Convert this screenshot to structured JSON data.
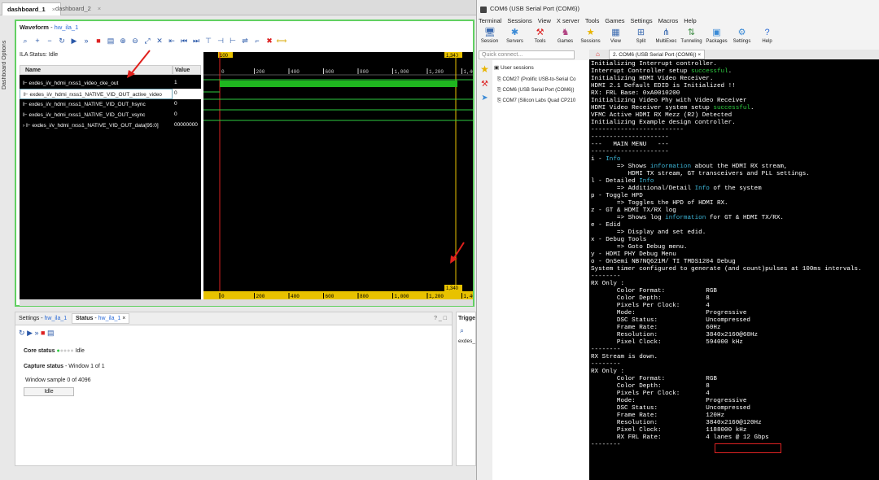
{
  "tabs": [
    {
      "label": "dashboard_1",
      "active": true
    },
    {
      "label": "dashboard_2",
      "active": false
    }
  ],
  "side_tab": "Dashboard Options",
  "waveform": {
    "title": "Waveform",
    "link": "hw_ila_1",
    "status_label": "ILA Status:",
    "status_value": "Idle",
    "name_header": "Name",
    "value_header": "Value",
    "signals": [
      {
        "name": "exdes_i/v_hdmi_rxss1_video_cke_out",
        "value": "1",
        "selected": false
      },
      {
        "name": "exdes_i/v_hdmi_rxss1_NATIVE_VID_OUT_active_video",
        "value": "0",
        "selected": true
      },
      {
        "name": "exdes_i/v_hdmi_rxss1_NATIVE_VID_OUT_hsync",
        "value": "0",
        "selected": false
      },
      {
        "name": "exdes_i/v_hdmi_rxss1_NATIVE_VID_OUT_vsync",
        "value": "0",
        "selected": false
      },
      {
        "name": "exdes_i/v_hdmi_rxss1_NATIVE_VID_OUT_data[95:0]",
        "value": "00000000",
        "selected": false
      }
    ],
    "top_marker": "100",
    "right_marker": "1,340",
    "bottom_marker": "1,340",
    "top_ticks": [
      "0",
      "200",
      "400",
      "600",
      "800",
      "1,000",
      "1,200",
      "1,400"
    ],
    "bottom_ticks": [
      "0",
      "200",
      "400",
      "600",
      "800",
      "1,000",
      "1,200",
      "1,400"
    ]
  },
  "settings_panel": {
    "tab1": "Settings",
    "tab1_link": "hw_ila_1",
    "tab2": "Status",
    "tab2_link": "hw_ila_1",
    "core_status_label": "Core status",
    "core_status_value": "Idle",
    "capture_status_label": "Capture status",
    "capture_status_value": "Window 1 of 1",
    "window_sample": "Window sample 0 of 4096",
    "idle_button": "Idle"
  },
  "trigger_panel": {
    "title": "Trigge",
    "row": "exdes_"
  },
  "mobaxterm": {
    "title": "COM6  (USB Serial Port (COM6))",
    "menu": [
      "Terminal",
      "Sessions",
      "View",
      "X server",
      "Tools",
      "Games",
      "Settings",
      "Macros",
      "Help"
    ],
    "toolbar": [
      "Session",
      "Servers",
      "Tools",
      "Games",
      "Sessions",
      "View",
      "Split",
      "MultiExec",
      "Tunneling",
      "Packages",
      "Settings",
      "Help"
    ],
    "quick_connect": "Quick connect...",
    "session_root": "User sessions",
    "sessions": [
      "COM27  (Prolific USB-to-Serial Co",
      "COM6  (USB Serial Port (COM6))",
      "COM7  (Silicon Labs Quad CP210"
    ],
    "term_tab": "2. COM6  (USB Serial Port (COM6))",
    "lines": [
      "Initializing Interrupt controller.",
      "Interrupt Controller setup successful.",
      "Initializing HDMI Video Receiver.",
      "HDMI 2.1 Default EDID is Initialized !!",
      "RX: FRL Base: 0xA0010200",
      "Initializing Video Phy with Video Receiver",
      "HDMI Video Receiver system setup successful.",
      "VFMC Active HDMI RX Mezz (R2) Detected",
      "Initializing Example design controller.",
      "-------------------------",
      "",
      "---------------------",
      "---   MAIN MENU   ---",
      "---------------------",
      "i - Info",
      "       => Shows information about the HDMI RX stream,",
      "          HDMI TX stream, GT transceivers and PLL settings.",
      "l - Detailed Info",
      "       => Additional/Detail Info of the system",
      "p - Toggle HPD",
      "       => Toggles the HPD of HDMI RX.",
      "z - GT & HDMI TX/RX log",
      "       => Shows log information for GT & HDMI TX/RX.",
      "e - Edid",
      "       => Display and set edid.",
      "x - Debug Tools",
      "       => Goto Debug menu.",
      "y - HDMI PHY Debug Menu",
      "o - OnSemi NB7NQ621M/ TI TMDS1204 Debug",
      "",
      "",
      "System timer configured to generate (and count)pulses at 100ms intervals.",
      "--------",
      "RX Only :",
      "       Color Format:           RGB",
      "       Color Depth:            8",
      "       Pixels Per Clock:       4",
      "       Mode:                   Progressive",
      "       DSC Status:             Uncompressed",
      "       Frame Rate:             60Hz",
      "       Resolution:             3840x2160@60Hz",
      "       Pixel Clock:            594000 kHz",
      "--------",
      "RX Stream is down.",
      "--------",
      "RX Only :",
      "       Color Format:           RGB",
      "       Color Depth:            8",
      "       Pixels Per Clock:       4",
      "       Mode:                   Progressive",
      "       DSC Status:             Uncompressed",
      "       Frame Rate:             120Hz",
      "       Resolution:             3840x2160@120Hz",
      "       Pixel Clock:            1188000 kHz",
      "       RX FRL Rate:            4 lanes @ 12 Gbps",
      "--------"
    ]
  }
}
